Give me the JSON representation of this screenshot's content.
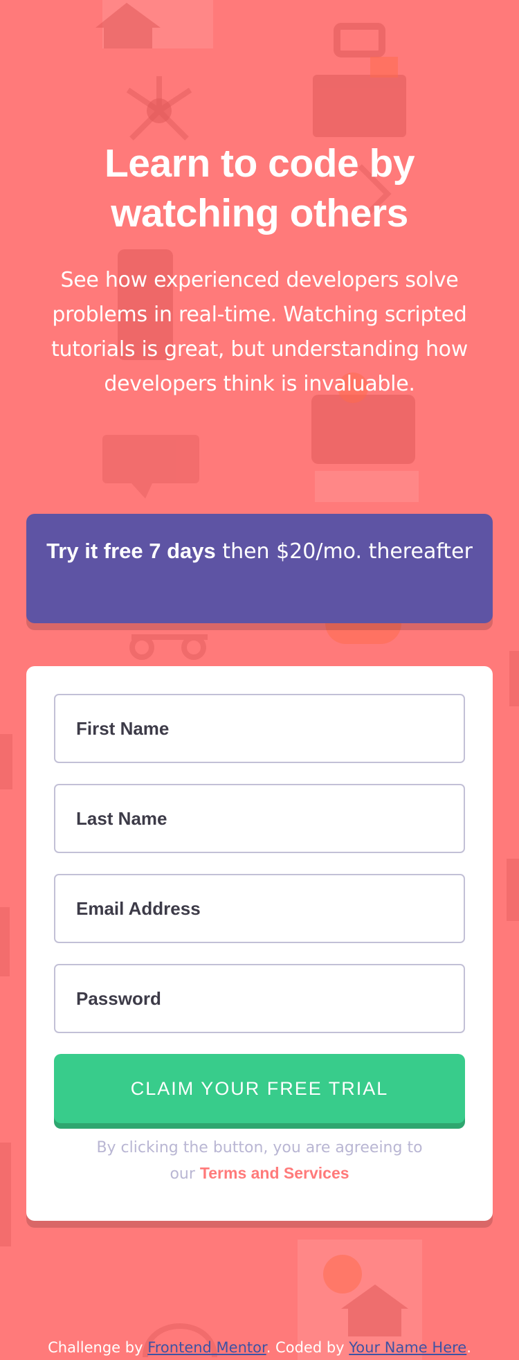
{
  "hero": {
    "title": "Learn to code by watching others",
    "description": "See how experienced developers solve problems in real-time. Watching scripted tutorials is great, but understanding how developers think is invaluable."
  },
  "promo": {
    "bold": "Try it free 7 days",
    "rest": " then $20/mo. thereafter"
  },
  "form": {
    "first_name_placeholder": "First Name",
    "last_name_placeholder": "Last Name",
    "email_placeholder": "Email Address",
    "password_placeholder": "Password",
    "submit_label": "CLAIM YOUR FREE TRIAL",
    "terms_prefix": "By clicking the button, you are agreeing to",
    "terms_our": "our ",
    "terms_link": "Terms and Services"
  },
  "attribution": {
    "prefix": "Challenge by ",
    "challenge_link": "Frontend Mentor",
    "middle": ". Coded by ",
    "author_link": "Your Name Here",
    "suffix": "."
  },
  "colors": {
    "background": "#ff7a7a",
    "promo": "#5e54a4",
    "cta": "#38cc8b",
    "cta_shadow": "#2ea66f",
    "terms_text": "#b9b6d3",
    "terms_link": "#ff7a7a",
    "field_text": "#3d3b48",
    "field_border": "#c2c0d6",
    "attribution_link": "#3e52a3"
  },
  "icons": {
    "background": "decorative-illustration-pattern"
  }
}
